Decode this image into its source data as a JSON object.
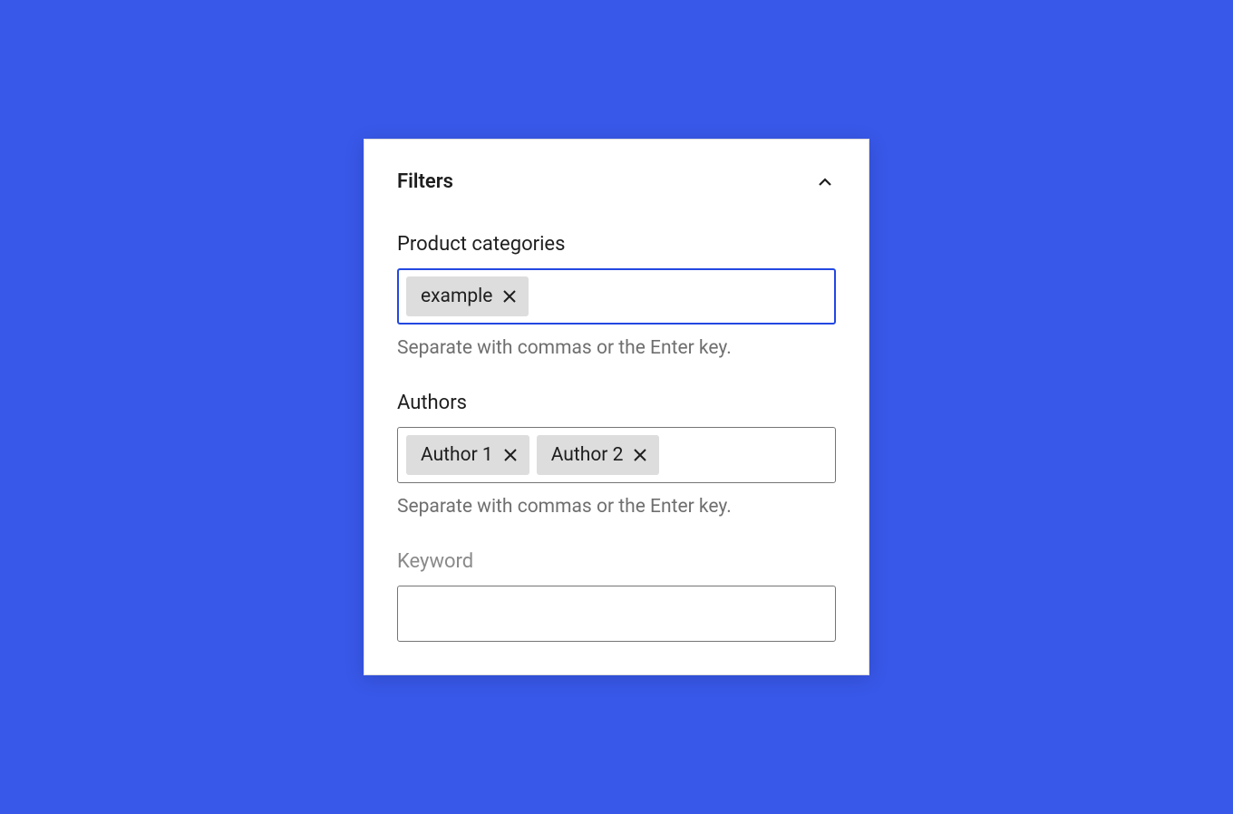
{
  "panel": {
    "title": "Filters"
  },
  "fields": {
    "productCategories": {
      "label": "Product categories",
      "tokens": [
        "example"
      ],
      "helperText": "Separate with commas or the Enter key."
    },
    "authors": {
      "label": "Authors",
      "tokens": [
        "Author 1",
        "Author 2"
      ],
      "helperText": "Separate with commas or the Enter key."
    },
    "keyword": {
      "label": "Keyword",
      "value": ""
    }
  }
}
